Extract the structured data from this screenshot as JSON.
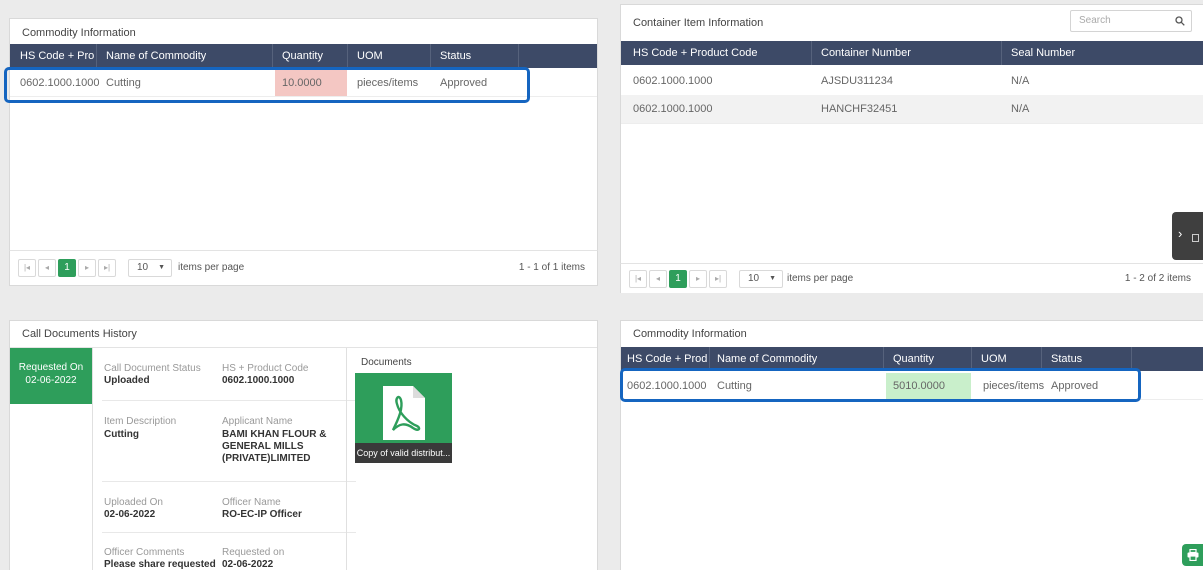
{
  "left_commodity": {
    "title": "Commodity Information",
    "columns": [
      "HS Code + Produ...",
      "Name of Commodity",
      "Quantity",
      "UOM",
      "Status"
    ],
    "rows": [
      {
        "hs_code": "0602.1000.1000",
        "name": "Cutting",
        "quantity": "10.0000",
        "uom": "pieces/items",
        "status": "Approved",
        "quantity_color": "#f4c7c3"
      }
    ],
    "pager": {
      "page": "1",
      "page_size": "10",
      "per_page_label": "items per page",
      "info": "1 - 1 of 1 items"
    }
  },
  "container_items": {
    "title": "Container Item Information",
    "search_placeholder": "Search",
    "columns": [
      "HS Code + Product Code",
      "Container Number",
      "Seal Number"
    ],
    "rows": [
      {
        "hs_code": "0602.1000.1000",
        "container": "AJSDU311234",
        "seal": "N/A"
      },
      {
        "hs_code": "0602.1000.1000",
        "container": "HANCHF32451",
        "seal": "N/A"
      }
    ],
    "pager": {
      "page": "1",
      "page_size": "10",
      "per_page_label": "items per page",
      "info": "1 - 2 of 2 items"
    }
  },
  "call_documents": {
    "title": "Call Documents History",
    "requested_on_label": "Requested On",
    "requested_on_value": "02-06-2022",
    "status_label": "Call Document Status",
    "status_value": "Uploaded",
    "hs_label": "HS + Product Code",
    "hs_value": "0602.1000.1000",
    "item_desc_label": "Item Description",
    "item_desc_value": "Cutting",
    "applicant_label": "Applicant Name",
    "applicant_value_1": "BAMI KHAN FLOUR &",
    "applicant_value_2": "GENERAL MILLS",
    "applicant_value_3": "(PRIVATE)LIMITED",
    "uploaded_on_label": "Uploaded On",
    "uploaded_on_value": "02-06-2022",
    "officer_name_label": "Officer Name",
    "officer_name_value": "RO-EC-IP Officer",
    "officer_comments_label": "Officer Comments",
    "officer_comments_value": "Please share requested",
    "requested_on2_label": "Requested on",
    "requested_on2_value": "02-06-2022",
    "documents_label": "Documents",
    "document_caption": "Copy of valid distribut...",
    "accent_color": "#2e9e5b"
  },
  "right_commodity": {
    "title": "Commodity Information",
    "columns": [
      "HS Code + Produc...",
      "Name of Commodity",
      "Quantity",
      "UOM",
      "Status"
    ],
    "rows": [
      {
        "hs_code": "0602.1000.1000",
        "name": "Cutting",
        "quantity": "5010.0000",
        "uom": "pieces/items",
        "status": "Approved",
        "quantity_color": "#c9efcb"
      }
    ]
  },
  "colors": {
    "header": "#3d4a67",
    "highlight": "#1565c0",
    "green": "#2e9e5b"
  },
  "icons": {
    "search": "search-icon",
    "side_toggle": "chevron-right-icon",
    "print": "print-icon",
    "pdf": "pdf-icon"
  }
}
